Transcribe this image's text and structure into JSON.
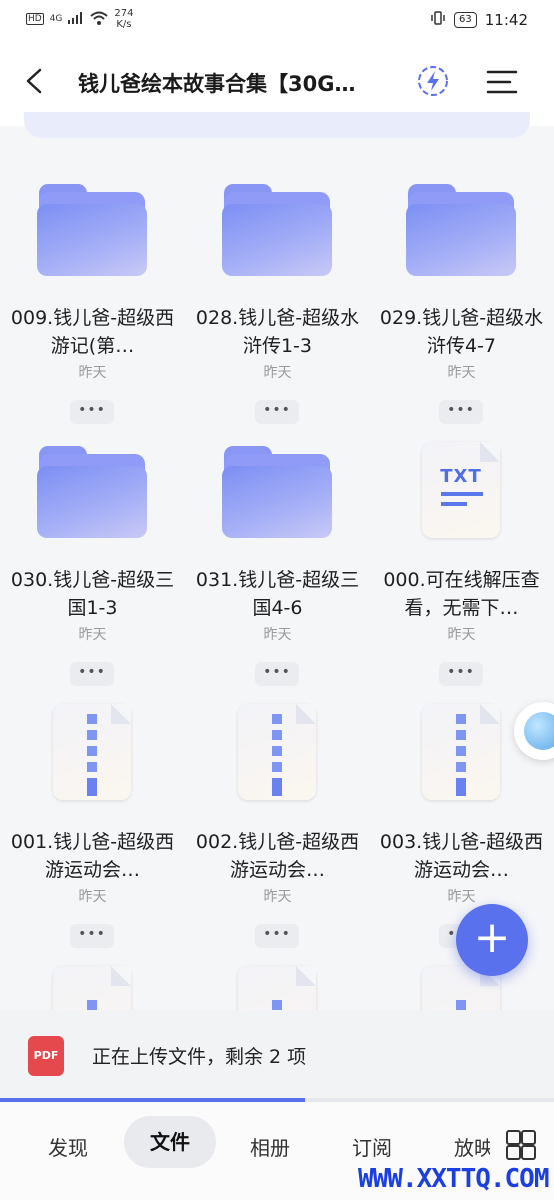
{
  "status_bar": {
    "network_type": "4G",
    "speed": "274",
    "speed_unit": "K/s",
    "battery": "63",
    "time": "11:42"
  },
  "header": {
    "title": "钱儿爸绘本故事合集【30G…"
  },
  "files": [
    {
      "type": "folder",
      "name": "009.钱儿爸-超级西游记(第…",
      "date": "昨天"
    },
    {
      "type": "folder",
      "name": "028.钱儿爸-超级水浒传1-3",
      "date": "昨天"
    },
    {
      "type": "folder",
      "name": "029.钱儿爸-超级水浒传4-7",
      "date": "昨天"
    },
    {
      "type": "folder",
      "name": "030.钱儿爸-超级三国1-3",
      "date": "昨天"
    },
    {
      "type": "folder",
      "name": "031.钱儿爸-超级三国4-6",
      "date": "昨天"
    },
    {
      "type": "txt",
      "name": "000.可在线解压查看，无需下…",
      "date": "昨天"
    },
    {
      "type": "zip",
      "name": "001.钱儿爸-超级西游运动会…",
      "date": "昨天"
    },
    {
      "type": "zip",
      "name": "002.钱儿爸-超级西游运动会…",
      "date": "昨天"
    },
    {
      "type": "zip",
      "name": "003.钱儿爸-超级西游运动会…",
      "date": "昨天"
    }
  ],
  "more_label": "•••",
  "txt_badge": "TXT",
  "upload": {
    "icon_label": "PDF",
    "text": "正在上传文件，剩余 2 项",
    "progress": 0.55
  },
  "fab_label": "+",
  "nav": {
    "discover": "发现",
    "files": "文件",
    "album": "相册",
    "subscribe": "订阅",
    "player": "放映"
  },
  "watermark": "WWW.XXTTQ.COM"
}
